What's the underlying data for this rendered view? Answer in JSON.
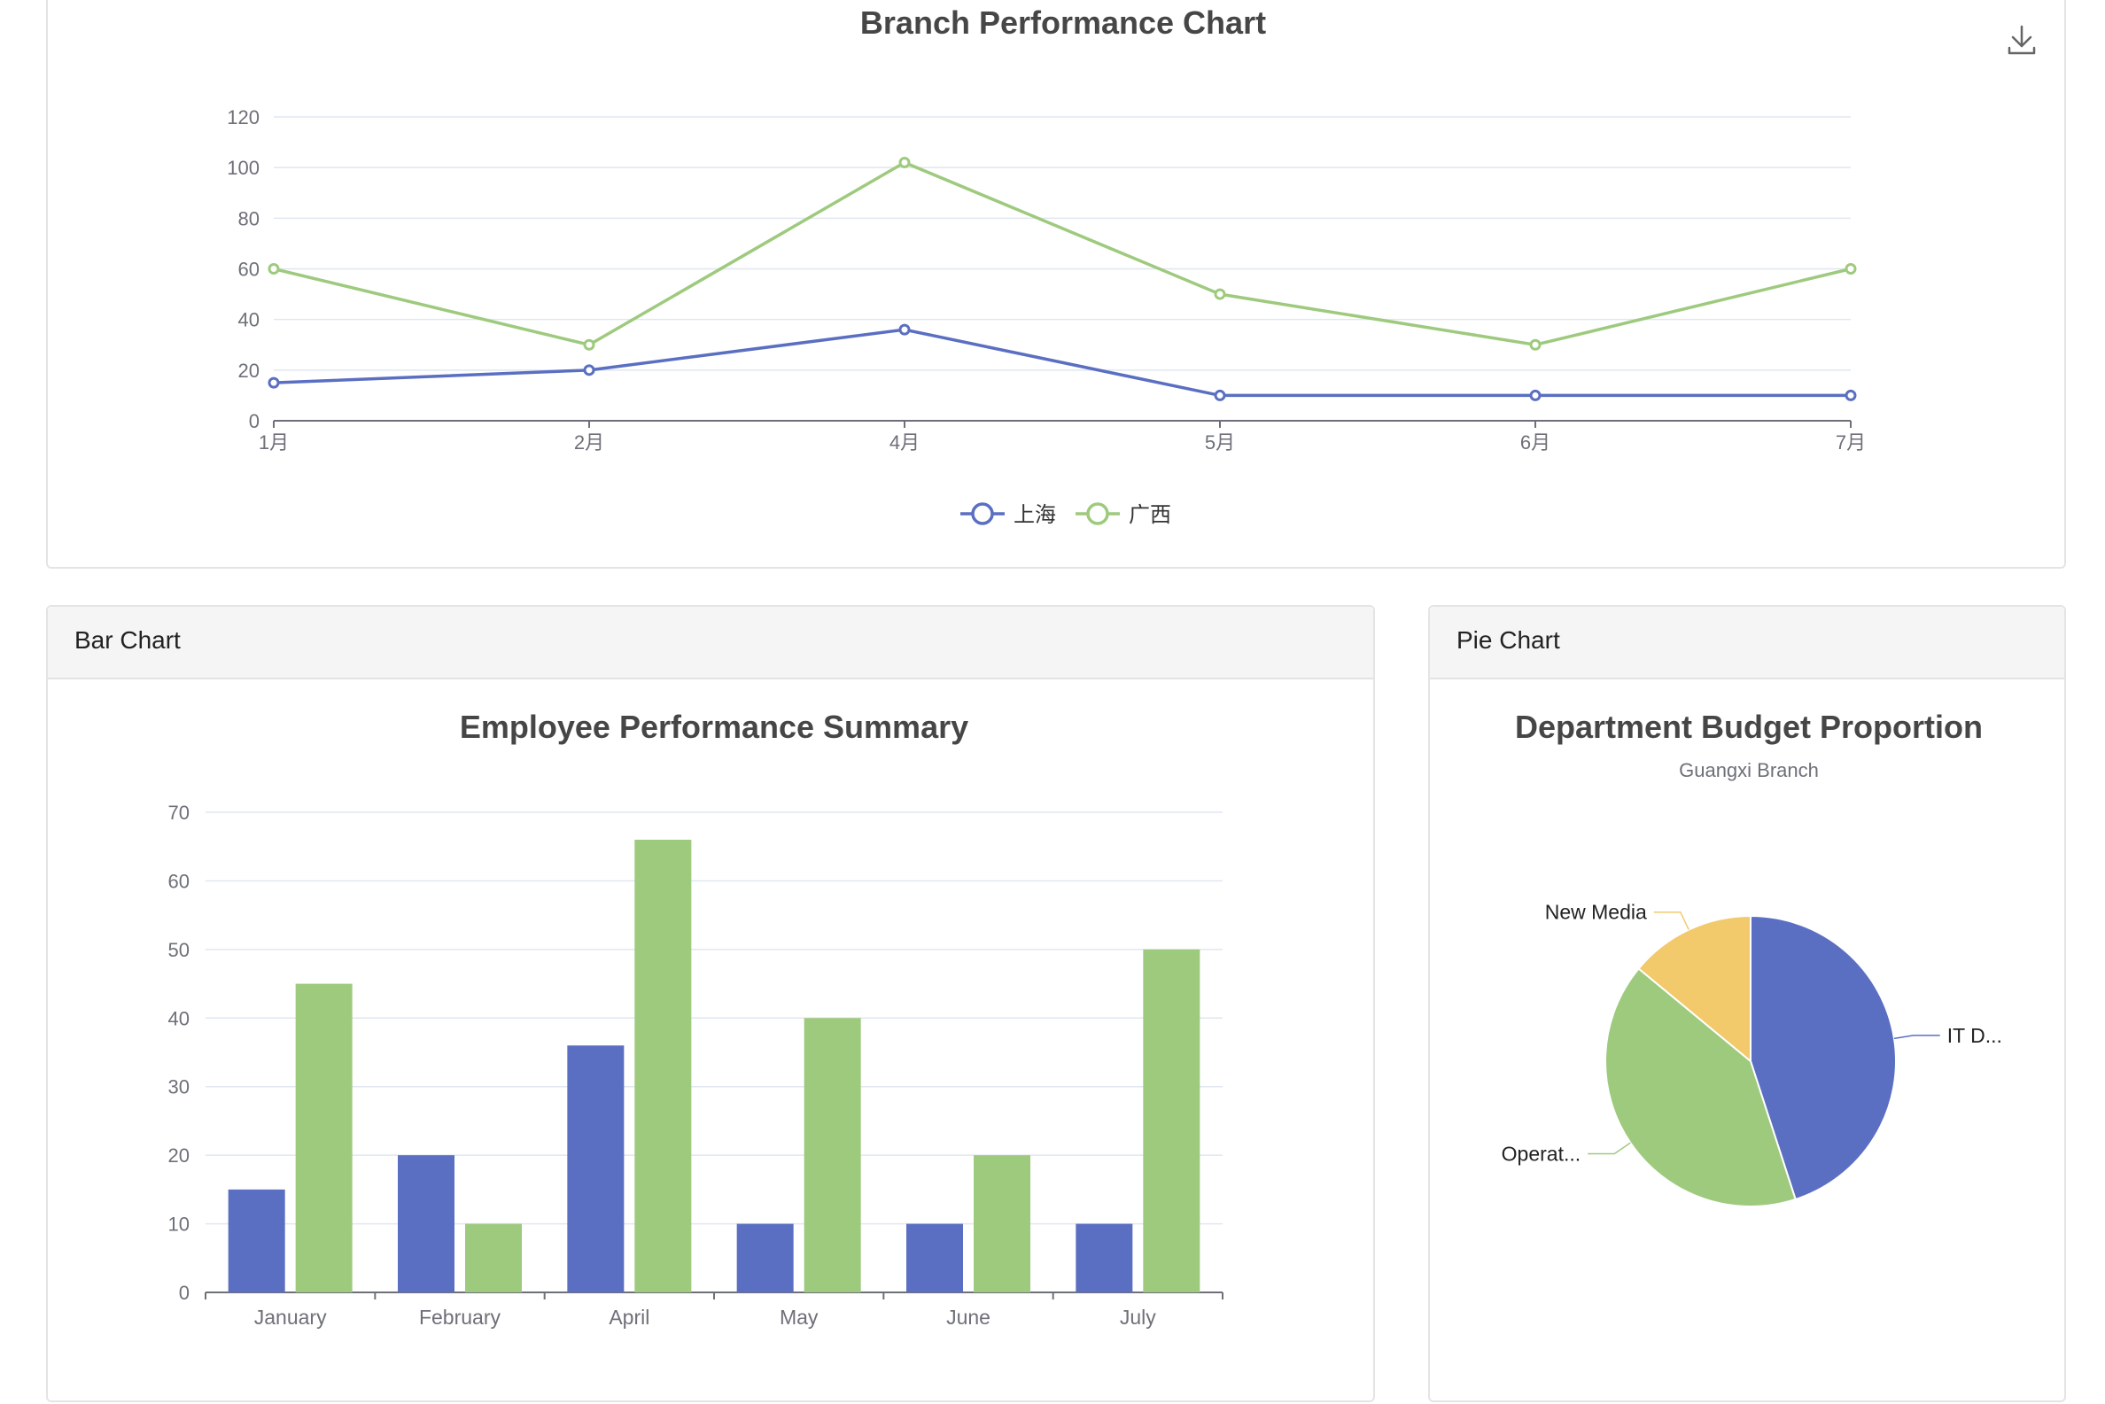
{
  "line_panel": {
    "download_icon": "download-icon"
  },
  "bar_panel": {
    "header": "Bar Chart"
  },
  "pie_panel": {
    "header": "Pie Chart"
  },
  "colors": {
    "blue": "#5b6fc2",
    "green": "#9eca7e",
    "yellow": "#f2c96b",
    "grid": "#e0e6f1",
    "axis": "#6e7079"
  },
  "chart_data": [
    {
      "type": "line",
      "title": "Branch Performance Chart",
      "categories": [
        "1月",
        "2月",
        "4月",
        "5月",
        "6月",
        "7月"
      ],
      "series": [
        {
          "name": "上海",
          "values": [
            15,
            20,
            36,
            10,
            10,
            10
          ]
        },
        {
          "name": "广西",
          "values": [
            60,
            30,
            102,
            50,
            30,
            60
          ]
        }
      ],
      "ylim": [
        0,
        120
      ],
      "yticks": [
        0,
        20,
        40,
        60,
        80,
        100,
        120
      ],
      "grid": true,
      "legend": "bottom-center"
    },
    {
      "type": "bar",
      "title": "Employee Performance Summary",
      "categories": [
        "January",
        "February",
        "April",
        "May",
        "June",
        "July"
      ],
      "series": [
        {
          "values": [
            15,
            20,
            36,
            10,
            10,
            10
          ]
        },
        {
          "values": [
            45,
            10,
            66,
            40,
            20,
            50
          ]
        }
      ],
      "ylim": [
        0,
        70
      ],
      "yticks": [
        0,
        10,
        20,
        30,
        40,
        50,
        60,
        70
      ],
      "grid": true
    },
    {
      "type": "pie",
      "title": "Department Budget Proportion",
      "subtitle": "Guangxi Branch",
      "slices": [
        {
          "label": "IT D...",
          "value": 45
        },
        {
          "label": "Operat...",
          "value": 41
        },
        {
          "label": "New Media",
          "value": 14
        }
      ]
    }
  ]
}
